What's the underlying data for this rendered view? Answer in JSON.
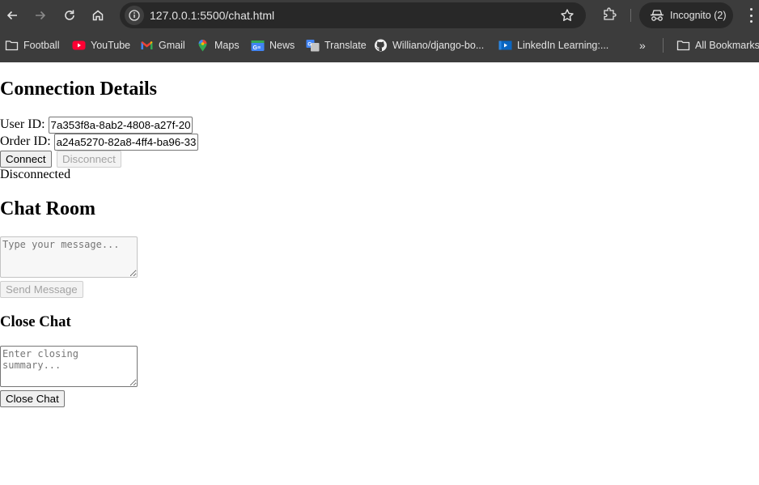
{
  "browser": {
    "url": "127.0.0.1:5500/chat.html",
    "incognito_label": "Incognito (2)",
    "icons": {
      "back": "arrow-left-icon",
      "forward": "arrow-right-icon",
      "reload": "reload-icon",
      "home": "home-icon",
      "site_info": "info-icon",
      "bookmark_star": "star-icon",
      "extensions": "puzzle-icon",
      "incognito": "incognito-icon",
      "menu": "kebab-menu-icon"
    },
    "bookmarks": [
      {
        "label": "Football",
        "icon": "folder-icon"
      },
      {
        "label": "YouTube",
        "icon": "youtube-icon"
      },
      {
        "label": "Gmail",
        "icon": "gmail-icon"
      },
      {
        "label": "Maps",
        "icon": "maps-pin-icon"
      },
      {
        "label": "News",
        "icon": "news-icon"
      },
      {
        "label": "Translate",
        "icon": "translate-icon"
      },
      {
        "label": "Williano/django-bo...",
        "icon": "github-icon"
      },
      {
        "label": "LinkedIn Learning:...",
        "icon": "linkedin-learning-icon"
      }
    ],
    "overflow_label": "»",
    "all_bookmarks_label": "All Bookmarks",
    "colors": {
      "chrome_bg": "#3c3c3c",
      "omnibox_bg": "#282828",
      "text": "#e3e3e3"
    }
  },
  "connection": {
    "heading": "Connection Details",
    "user_id_label": "User ID:",
    "user_id_value": "7a353f8a-8ab2-4808-a27f-20",
    "order_id_label": "Order ID:",
    "order_id_value": "a24a5270-82a8-4ff4-ba96-33",
    "connect_label": "Connect",
    "disconnect_label": "Disconnect",
    "status_text": "Disconnected"
  },
  "chat_room": {
    "heading": "Chat Room",
    "message_placeholder": "Type your message...",
    "send_label": "Send Message"
  },
  "close_chat": {
    "heading": "Close Chat",
    "summary_placeholder": "Enter closing summary...",
    "close_label": "Close Chat"
  }
}
